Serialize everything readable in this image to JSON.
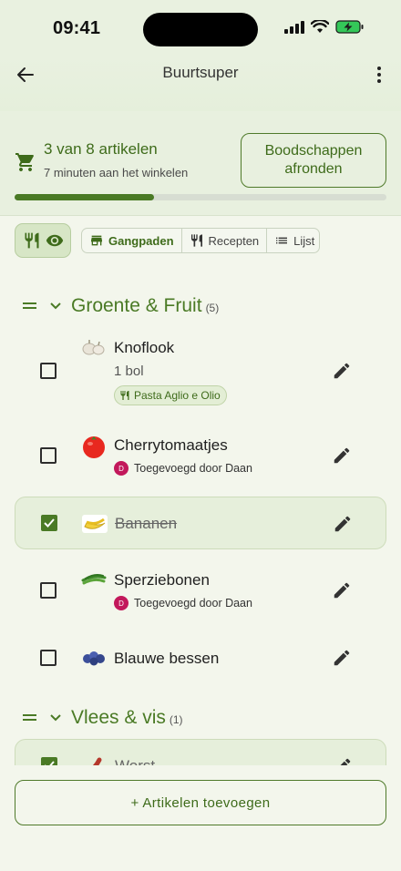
{
  "status_bar": {
    "time": "09:41"
  },
  "app_bar": {
    "title": "Buurtsuper"
  },
  "progress": {
    "count_text": "3 van 8 artikelen",
    "elapsed_text": "7 minuten aan het winkelen",
    "finish_button": "Boodschappen afronden",
    "fraction": 0.375
  },
  "view_tabs": [
    {
      "label": "Gangpaden",
      "icon": "store-icon",
      "active": true
    },
    {
      "label": "Recepten",
      "icon": "fork-knife-icon",
      "active": false
    },
    {
      "label": "Lijst",
      "icon": "list-icon",
      "active": false
    }
  ],
  "sections": [
    {
      "name": "Groente & Fruit",
      "count": "(5)",
      "items": [
        {
          "name": "Knoflook",
          "qty": "1 bol",
          "recipe": "Pasta Aglio e Olio",
          "checked": false,
          "thumb": "garlic"
        },
        {
          "name": "Cherrytomaatjes",
          "added_by": "Toegevoegd door Daan",
          "avatar": "D",
          "checked": false,
          "thumb": "tomato"
        },
        {
          "name": "Bananen",
          "checked": true,
          "thumb": "banana"
        },
        {
          "name": "Sperziebonen",
          "added_by": "Toegevoegd door Daan",
          "avatar": "D",
          "checked": false,
          "thumb": "beans"
        },
        {
          "name": "Blauwe bessen",
          "checked": false,
          "thumb": "blueberries"
        }
      ]
    },
    {
      "name": "Vlees & vis",
      "count": "(1)",
      "items": [
        {
          "name": "Worst",
          "checked": true,
          "thumb": "sausage"
        }
      ]
    }
  ],
  "add_button": "+ Artikelen toevoegen",
  "colors": {
    "accent": "#4a7a25",
    "background": "#f3f6ec",
    "avatar": "#c2185b"
  }
}
